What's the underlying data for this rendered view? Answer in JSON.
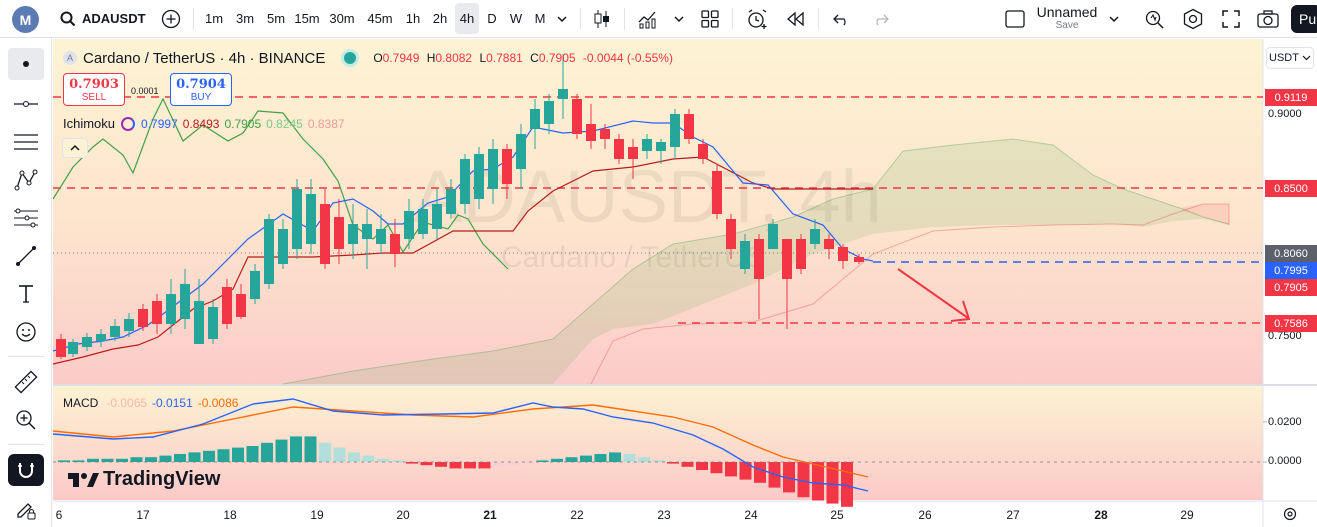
{
  "toolbar": {
    "logo": "M",
    "symbol": "ADAUSDT",
    "intervals": [
      "1m",
      "3m",
      "5m",
      "15m",
      "30m",
      "45m",
      "1h",
      "2h",
      "4h",
      "D",
      "W",
      "M"
    ],
    "selected_interval": "4h",
    "layout_name": "Unnamed",
    "layout_status": "Save",
    "publish_label": "Pu"
  },
  "legend": {
    "title": "Cardano / TetherUS · 4h · BINANCE",
    "open_label": "O",
    "open": "0.7949",
    "high_label": "H",
    "high": "0.8082",
    "low_label": "L",
    "low": "0.7881",
    "close_label": "C",
    "close": "0.7905",
    "change": "-0.0044 (-0.55%)"
  },
  "trade": {
    "sell_price": "0.7903",
    "sell_label": "SELL",
    "spread": "0.0001",
    "buy_price": "0.7904",
    "buy_label": "BUY"
  },
  "ichimoku": {
    "label": "Ichimoku",
    "v1": "0.7997",
    "v2": "0.8493",
    "v3": "0.7905",
    "v4": "0.8245",
    "v5": "0.8387"
  },
  "watermark": {
    "symbol": "ADAUSDT, 4h",
    "name": "Cardano / TetherUS"
  },
  "currency_selector": "USDT",
  "price_axis": {
    "ticks": [
      "0.9000",
      "0.7500"
    ],
    "labels": {
      "line_top": "0.9119",
      "line_mid": "0.8500",
      "last": "0.8060",
      "current": "0.7995",
      "close": "0.7905",
      "line_low": "0.7586"
    }
  },
  "macd": {
    "label": "MACD",
    "v1": "-0.0065",
    "v2": "-0.0151",
    "v3": "-0.0086",
    "ticks": [
      "0.0200",
      "0.0000"
    ]
  },
  "branding": "TradingView",
  "dates": [
    "6",
    "17",
    "18",
    "19",
    "20",
    "21",
    "22",
    "23",
    "24",
    "25",
    "26",
    "27",
    "28",
    "29"
  ],
  "colors": {
    "up": "#26a69a",
    "down": "#f23645",
    "tenkan": "#2962ff",
    "kijun": "#b71c1c",
    "lagging": "#43a047",
    "macd_line": "#2962ff",
    "signal_line": "#ff6d00"
  }
}
